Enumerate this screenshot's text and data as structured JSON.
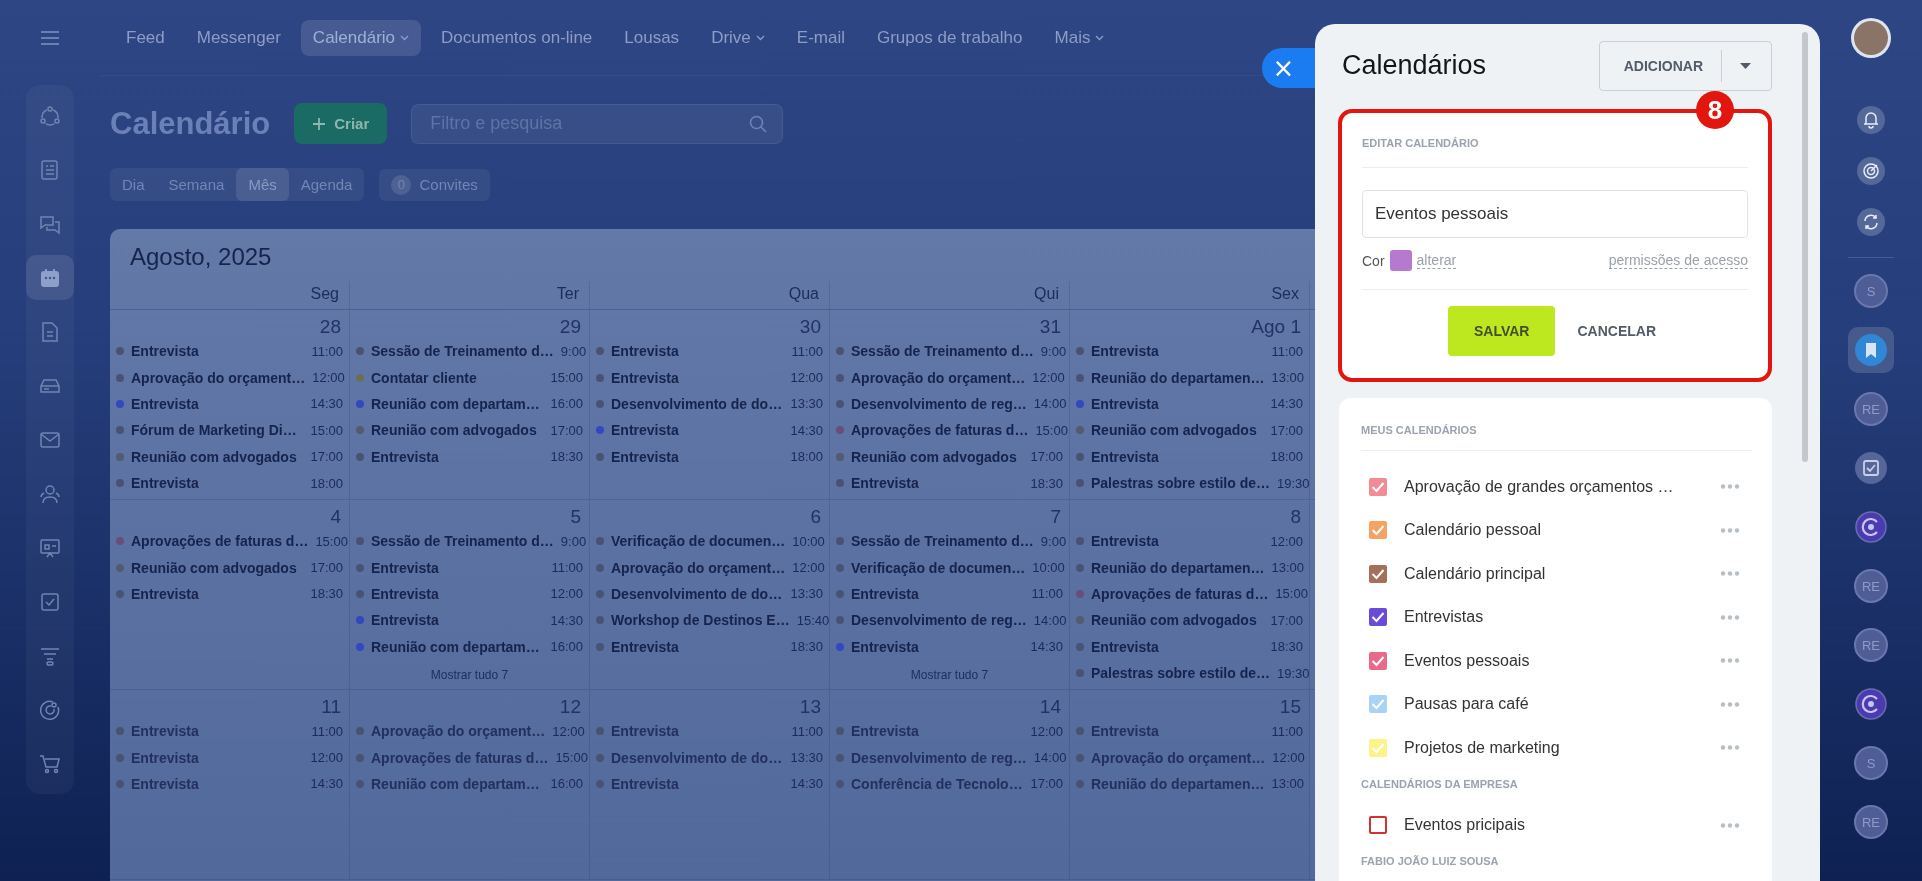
{
  "left_sidebar": {
    "menu_button": {
      "kind": "menu"
    },
    "items": [
      {
        "kind": "network",
        "selected": false
      },
      {
        "kind": "news",
        "selected": false
      },
      {
        "kind": "chat",
        "selected": false
      },
      {
        "kind": "calendar",
        "selected": true
      },
      {
        "kind": "document",
        "selected": false
      },
      {
        "kind": "drive",
        "selected": false
      },
      {
        "kind": "mail",
        "selected": false
      },
      {
        "kind": "people",
        "selected": false
      },
      {
        "kind": "board",
        "selected": false
      },
      {
        "kind": "task",
        "selected": false
      },
      {
        "kind": "funnel",
        "selected": false
      },
      {
        "kind": "target",
        "selected": false
      },
      {
        "kind": "cart",
        "selected": false
      }
    ]
  },
  "top_nav": {
    "items": [
      {
        "label": "Feed",
        "selected": false,
        "dropdown": false
      },
      {
        "label": "Messenger",
        "selected": false,
        "dropdown": false
      },
      {
        "label": "Calendário",
        "selected": true,
        "dropdown": true
      },
      {
        "label": "Documentos on-line",
        "selected": false,
        "dropdown": false
      },
      {
        "label": "Lousas",
        "selected": false,
        "dropdown": false
      },
      {
        "label": "Drive",
        "selected": false,
        "dropdown": true
      },
      {
        "label": "E-mail",
        "selected": false,
        "dropdown": false
      },
      {
        "label": "Grupos de trabalho",
        "selected": false,
        "dropdown": false
      },
      {
        "label": "Mais",
        "selected": false,
        "dropdown": true
      }
    ]
  },
  "header": {
    "title": "Calendário",
    "create_button": "Criar",
    "search": {
      "placeholder": "Filtro e pesquisa"
    }
  },
  "view_tabs": [
    {
      "label": "Dia",
      "selected": false
    },
    {
      "label": "Semana",
      "selected": false
    },
    {
      "label": "Mês",
      "selected": true
    },
    {
      "label": "Agenda",
      "selected": false
    }
  ],
  "invitations": {
    "count": "0",
    "label": "Convites"
  },
  "calendar": {
    "month": "Agosto, 2025",
    "weekdays": [
      "Seg",
      "Ter",
      "Qua",
      "Qui",
      "Sex"
    ],
    "weeks": [
      {
        "days": [
          {
            "date": "28",
            "events": [
              {
                "title": "Entrevista",
                "time": "11:00",
                "color": "#4a5274"
              },
              {
                "title": "Aprovação do orçament…",
                "time": "12:00",
                "color": "#4a5274"
              },
              {
                "title": "Entrevista",
                "time": "14:30",
                "color": "#3447c0"
              },
              {
                "title": "Fórum de Marketing Di…",
                "time": "15:00",
                "color": "#4a5274"
              },
              {
                "title": "Reunião com advogados",
                "time": "17:00",
                "color": "#545a70"
              },
              {
                "title": "Entrevista",
                "time": "18:00",
                "color": "#4a5274"
              }
            ]
          },
          {
            "date": "29",
            "events": [
              {
                "title": "Sessão de Treinamento d…",
                "time": "9:00",
                "color": "#4a5274"
              },
              {
                "title": "Contatar cliente",
                "time": "15:00",
                "color": "#6a6e58"
              },
              {
                "title": "Reunião com departam…",
                "time": "16:00",
                "color": "#3447c0"
              },
              {
                "title": "Reunião com advogados",
                "time": "17:00",
                "color": "#545a70"
              },
              {
                "title": "Entrevista",
                "time": "18:30",
                "color": "#4a5274"
              }
            ]
          },
          {
            "date": "30",
            "events": [
              {
                "title": "Entrevista",
                "time": "11:00",
                "color": "#4a5274"
              },
              {
                "title": "Entrevista",
                "time": "12:00",
                "color": "#4a5274"
              },
              {
                "title": "Desenvolvimento de do…",
                "time": "13:30",
                "color": "#4a5274"
              },
              {
                "title": "Entrevista",
                "time": "14:30",
                "color": "#3447c0"
              },
              {
                "title": "Entrevista",
                "time": "18:00",
                "color": "#4a5274"
              }
            ]
          },
          {
            "date": "31",
            "events": [
              {
                "title": "Sessão de Treinamento d…",
                "time": "9:00",
                "color": "#4a5274"
              },
              {
                "title": "Aprovação do orçament…",
                "time": "12:00",
                "color": "#4a5274"
              },
              {
                "title": "Desenvolvimento de reg…",
                "time": "14:00",
                "color": "#4a5274"
              },
              {
                "title": "Aprovações de faturas d…",
                "time": "15:00",
                "color": "#6a4e7a"
              },
              {
                "title": "Reunião com advogados",
                "time": "17:00",
                "color": "#545a70"
              },
              {
                "title": "Entrevista",
                "time": "18:30",
                "color": "#4a5274"
              }
            ]
          },
          {
            "date": "Ago 1",
            "events": [
              {
                "title": "Entrevista",
                "time": "11:00",
                "color": "#4a5274"
              },
              {
                "title": "Reunião do departamen…",
                "time": "13:00",
                "color": "#4a5274"
              },
              {
                "title": "Entrevista",
                "time": "14:30",
                "color": "#3447c0"
              },
              {
                "title": "Reunião com advogados",
                "time": "17:00",
                "color": "#545a70"
              },
              {
                "title": "Entrevista",
                "time": "18:00",
                "color": "#4a5274"
              },
              {
                "title": "Palestras sobre estilo de…",
                "time": "19:30",
                "color": "#4a5274"
              }
            ]
          }
        ]
      },
      {
        "days": [
          {
            "date": "4",
            "events": [
              {
                "title": "Aprovações de faturas d…",
                "time": "15:00",
                "color": "#6a4e7a"
              },
              {
                "title": "Reunião com advogados",
                "time": "17:00",
                "color": "#545a70"
              },
              {
                "title": "Entrevista",
                "time": "18:30",
                "color": "#4a5274"
              }
            ]
          },
          {
            "date": "5",
            "events": [
              {
                "title": "Sessão de Treinamento d…",
                "time": "9:00",
                "color": "#4a5274"
              },
              {
                "title": "Entrevista",
                "time": "11:00",
                "color": "#4a5274"
              },
              {
                "title": "Entrevista",
                "time": "12:00",
                "color": "#4a5274"
              },
              {
                "title": "Entrevista",
                "time": "14:30",
                "color": "#3447c0"
              },
              {
                "title": "Reunião com departam…",
                "time": "16:00",
                "color": "#3447c0"
              }
            ],
            "more": "Mostrar tudo 7"
          },
          {
            "date": "6",
            "events": [
              {
                "title": "Verificação de documen…",
                "time": "10:00",
                "color": "#4a5274"
              },
              {
                "title": "Aprovação do orçament…",
                "time": "12:00",
                "color": "#4a5274"
              },
              {
                "title": "Desenvolvimento de do…",
                "time": "13:30",
                "color": "#4a5274"
              },
              {
                "title": "Workshop de Destinos E…",
                "time": "15:40",
                "color": "#4a5274"
              },
              {
                "title": "Entrevista",
                "time": "18:30",
                "color": "#4a5274"
              }
            ]
          },
          {
            "date": "7",
            "events": [
              {
                "title": "Sessão de Treinamento d…",
                "time": "9:00",
                "color": "#4a5274"
              },
              {
                "title": "Verificação de documen…",
                "time": "10:00",
                "color": "#4a5274"
              },
              {
                "title": "Entrevista",
                "time": "11:00",
                "color": "#4a5274"
              },
              {
                "title": "Desenvolvimento de reg…",
                "time": "14:00",
                "color": "#4a5274"
              },
              {
                "title": "Entrevista",
                "time": "14:30",
                "color": "#3447c0"
              }
            ],
            "more": "Mostrar tudo 7"
          },
          {
            "date": "8",
            "events": [
              {
                "title": "Entrevista",
                "time": "12:00",
                "color": "#4a5274"
              },
              {
                "title": "Reunião do departamen…",
                "time": "13:00",
                "color": "#4a5274"
              },
              {
                "title": "Aprovações de faturas d…",
                "time": "15:00",
                "color": "#6a4e7a"
              },
              {
                "title": "Reunião com advogados",
                "time": "17:00",
                "color": "#545a70"
              },
              {
                "title": "Entrevista",
                "time": "18:30",
                "color": "#4a5274"
              },
              {
                "title": "Palestras sobre estilo de…",
                "time": "19:30",
                "color": "#4a5274"
              }
            ]
          }
        ]
      },
      {
        "days": [
          {
            "date": "11",
            "events": [
              {
                "title": "Entrevista",
                "time": "11:00",
                "color": "#4a5274"
              },
              {
                "title": "Entrevista",
                "time": "12:00",
                "color": "#4a5274"
              },
              {
                "title": "Entrevista",
                "time": "14:30",
                "color": "#4a5274"
              }
            ]
          },
          {
            "date": "12",
            "events": [
              {
                "title": "Aprovação do orçament…",
                "time": "12:00",
                "color": "#4a5274"
              },
              {
                "title": "Aprovações de faturas d…",
                "time": "15:00",
                "color": "#4a5274"
              },
              {
                "title": "Reunião com departam…",
                "time": "16:00",
                "color": "#4a5274"
              }
            ]
          },
          {
            "date": "13",
            "events": [
              {
                "title": "Entrevista",
                "time": "11:00",
                "color": "#4a5274"
              },
              {
                "title": "Desenvolvimento de do…",
                "time": "13:30",
                "color": "#4a5274"
              },
              {
                "title": "Entrevista",
                "time": "14:30",
                "color": "#4a5274"
              }
            ]
          },
          {
            "date": "14",
            "events": [
              {
                "title": "Entrevista",
                "time": "12:00",
                "color": "#4a5274"
              },
              {
                "title": "Desenvolvimento de reg…",
                "time": "14:00",
                "color": "#4a5274"
              },
              {
                "title": "Conferência de Tecnolo…",
                "time": "17:00",
                "color": "#4a5274"
              }
            ]
          },
          {
            "date": "15",
            "events": [
              {
                "title": "Entrevista",
                "time": "11:00",
                "color": "#4a5274"
              },
              {
                "title": "Aprovação do orçament…",
                "time": "12:00",
                "color": "#4a5274"
              },
              {
                "title": "Reunião do departamen…",
                "time": "13:00",
                "color": "#4a5274"
              }
            ]
          }
        ]
      }
    ]
  },
  "panel": {
    "close_button": "×",
    "title": "Calendários",
    "add_button": "ADICIONAR",
    "step_badge": "8",
    "edit_form": {
      "heading": "EDITAR CALENDÁRIO",
      "name_value": "Eventos pessoais",
      "color_label": "Cor",
      "color": "#b57ad0",
      "change_link": "alterar",
      "access_link": "permissões de acesso",
      "save_button": "SALVAR",
      "cancel_button": "CANCELAR"
    },
    "sections": [
      {
        "heading": "MEUS CALENDÁRIOS",
        "items": [
          {
            "name": "Aprovação de grandes orçamentos …",
            "color": "#f28b95",
            "checked": true
          },
          {
            "name": "Calendário pessoal",
            "color": "#f5a263",
            "checked": true
          },
          {
            "name": "Calendário principal",
            "color": "#a5705a",
            "checked": true
          },
          {
            "name": "Entrevistas",
            "color": "#6a4bd8",
            "checked": true
          },
          {
            "name": "Eventos pessoais",
            "color": "#e8698a",
            "checked": true
          },
          {
            "name": "Pausas para café",
            "color": "#a9d2f5",
            "checked": true
          },
          {
            "name": "Projetos de marketing",
            "color": "#fbf48a",
            "checked": true
          }
        ]
      },
      {
        "heading": "CALENDÁRIOS DA EMPRESA",
        "items": [
          {
            "name": "Eventos pricipais",
            "color": "#d3302f",
            "checked": false
          }
        ]
      },
      {
        "heading": "FABIO JOÃO LUIZ SOUSA"
      }
    ]
  },
  "right_sidebar": {
    "top_items": [
      {
        "kind": "avatar"
      },
      {
        "kind": "bell"
      },
      {
        "kind": "target"
      },
      {
        "kind": "sync"
      }
    ],
    "bottom_items": [
      {
        "kind": "initials",
        "text": "S",
        "selected": false
      },
      {
        "kind": "bookmark",
        "selected": true
      },
      {
        "kind": "initials",
        "text": "RE",
        "selected": false
      },
      {
        "kind": "checklist",
        "selected": false
      },
      {
        "kind": "swirl",
        "selected": false
      },
      {
        "kind": "initials",
        "text": "RE",
        "selected": false
      },
      {
        "kind": "initials",
        "text": "RE",
        "selected": false
      },
      {
        "kind": "swirl",
        "selected": false
      },
      {
        "kind": "initials",
        "text": "S",
        "selected": false
      },
      {
        "kind": "initials",
        "text": "RE",
        "selected": false
      }
    ]
  }
}
